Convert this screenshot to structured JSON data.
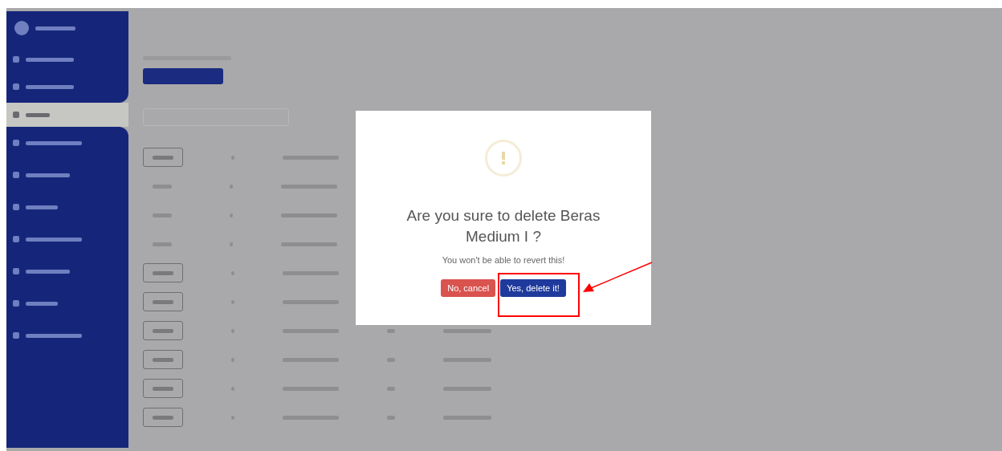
{
  "sidebar": {
    "items": [
      {
        "selected": false
      },
      {
        "selected": false
      },
      {
        "selected": true
      },
      {
        "selected": false
      },
      {
        "selected": false
      },
      {
        "selected": false
      },
      {
        "selected": false
      },
      {
        "selected": false
      },
      {
        "selected": false
      },
      {
        "selected": false
      }
    ]
  },
  "table": {
    "rows": [
      {
        "kind": "button"
      },
      {
        "kind": "text"
      },
      {
        "kind": "text"
      },
      {
        "kind": "text"
      },
      {
        "kind": "button"
      },
      {
        "kind": "button"
      },
      {
        "kind": "button"
      },
      {
        "kind": "button"
      },
      {
        "kind": "button"
      },
      {
        "kind": "button"
      }
    ]
  },
  "dialog": {
    "title": "Are you sure to delete Beras Medium I ?",
    "message": "You won't be able to revert this!",
    "buttons": [
      {
        "label": "No, cancel",
        "kind": "cancel"
      },
      {
        "label": "Yes, delete it!",
        "kind": "confirm",
        "highlighted": true
      }
    ]
  }
}
